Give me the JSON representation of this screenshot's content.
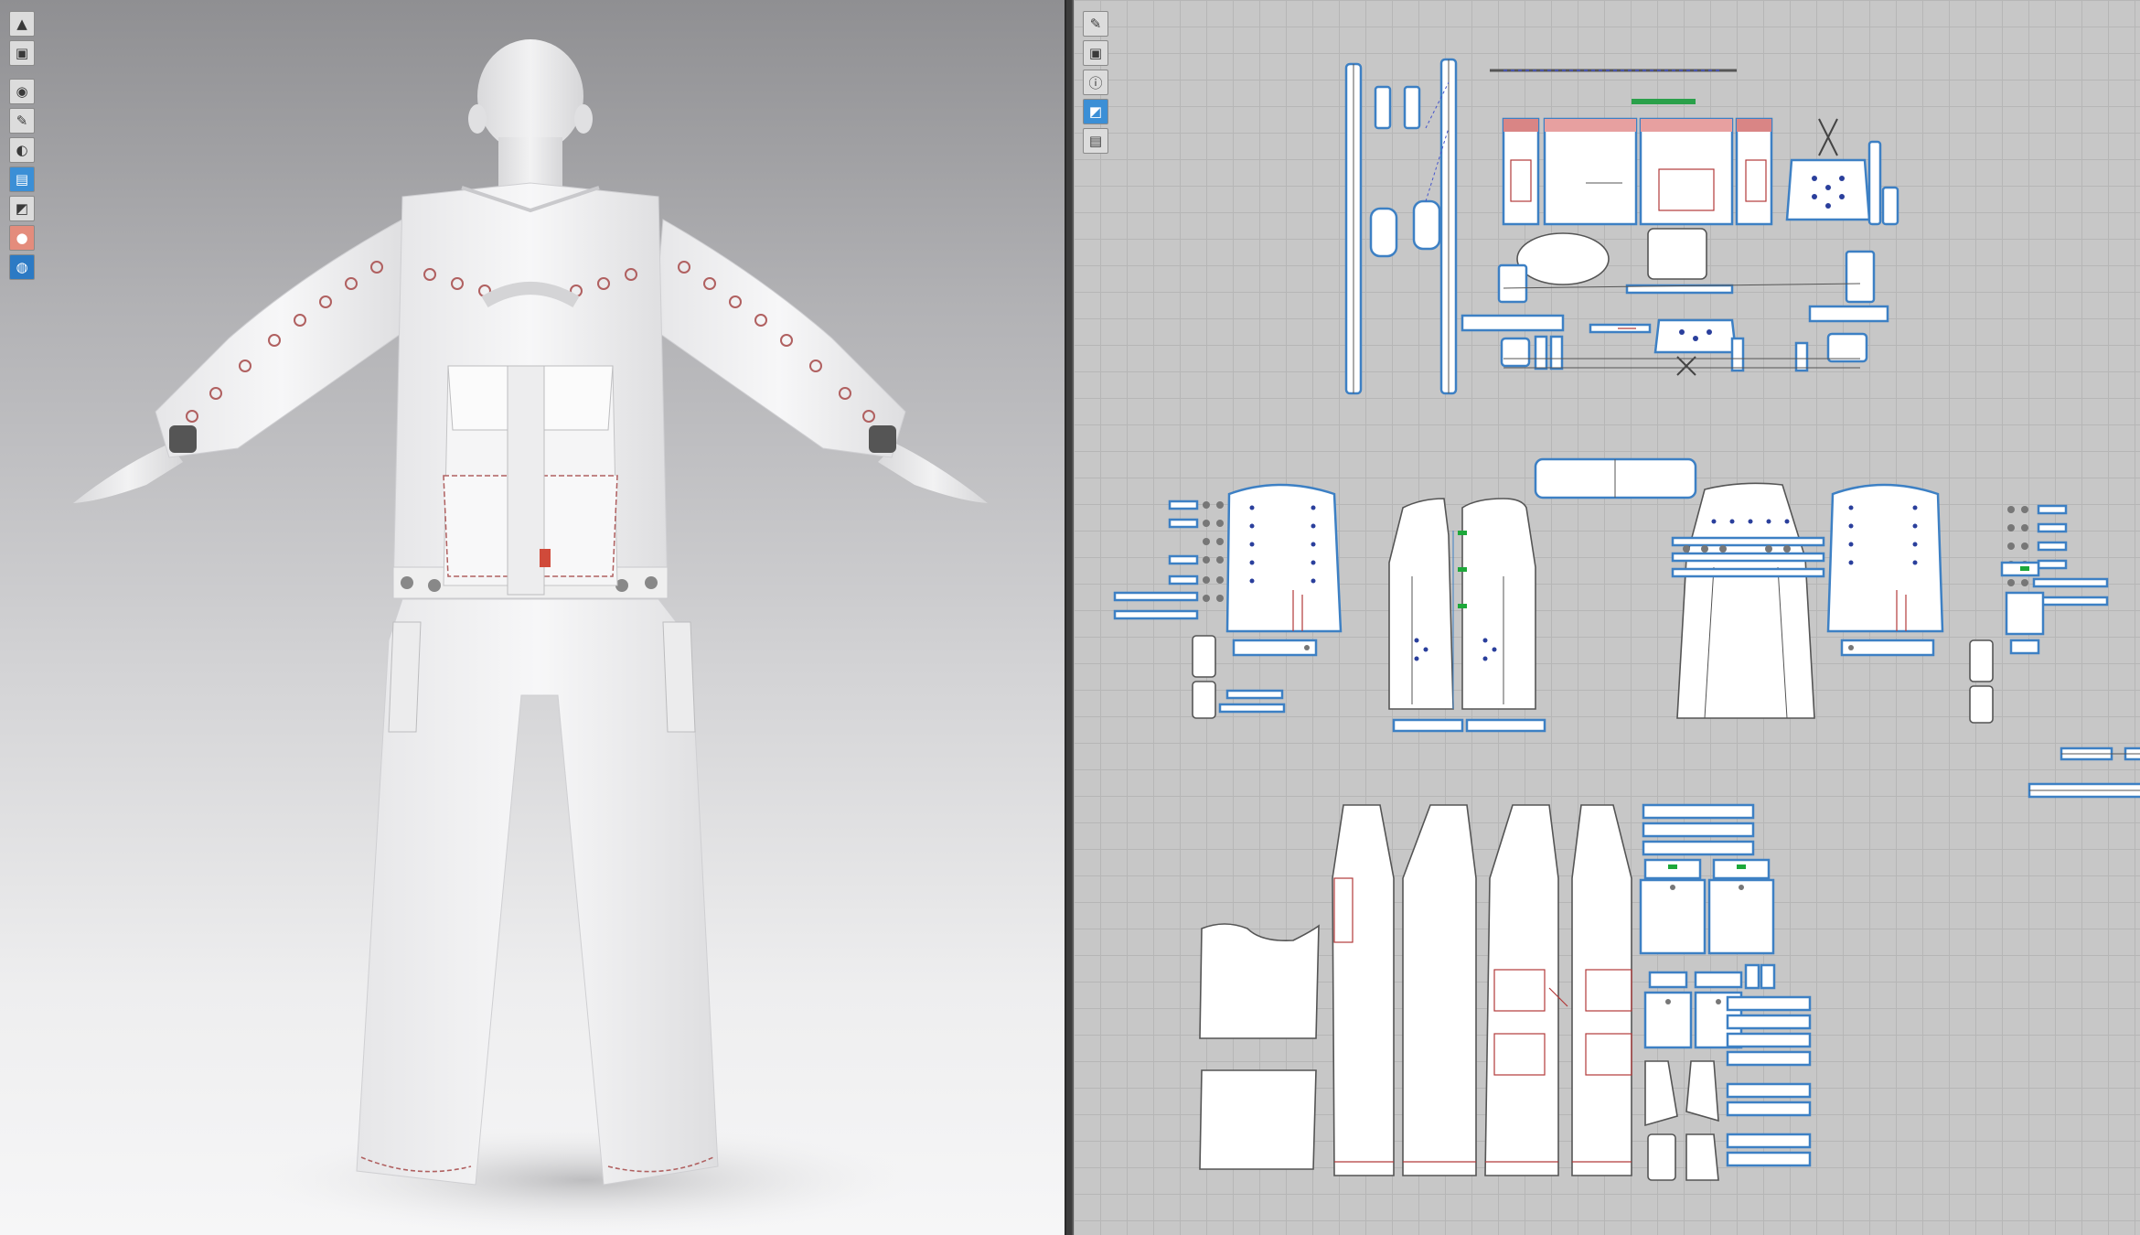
{
  "viewports": {
    "left": {
      "name": "3D Garment Window"
    },
    "right": {
      "name": "2D Pattern Window"
    }
  },
  "toolbar3d": {
    "tools": [
      {
        "icon": "simulation-avatar-icon"
      },
      {
        "icon": "garment-icon"
      },
      {
        "icon": "show-avatar-icon"
      },
      {
        "icon": "show-garment-icon"
      },
      {
        "icon": "fabric-view-icon"
      },
      {
        "icon": "texture-view-icon"
      },
      {
        "icon": "mesh-view-icon"
      },
      {
        "icon": "avatar-skin-icon"
      },
      {
        "icon": "environment-globe-icon"
      }
    ]
  },
  "toolbar2d": {
    "tools": [
      {
        "icon": "pattern-edit-icon"
      },
      {
        "icon": "garment-layer-icon"
      },
      {
        "icon": "info-icon"
      },
      {
        "icon": "texture-icon"
      },
      {
        "icon": "lock-icon"
      }
    ]
  },
  "colors": {
    "pattern_outline": "#3d80c4",
    "seam_line": "#b23a3a",
    "button_marks": "#2a3f9c",
    "grainline": "#1da83a"
  }
}
